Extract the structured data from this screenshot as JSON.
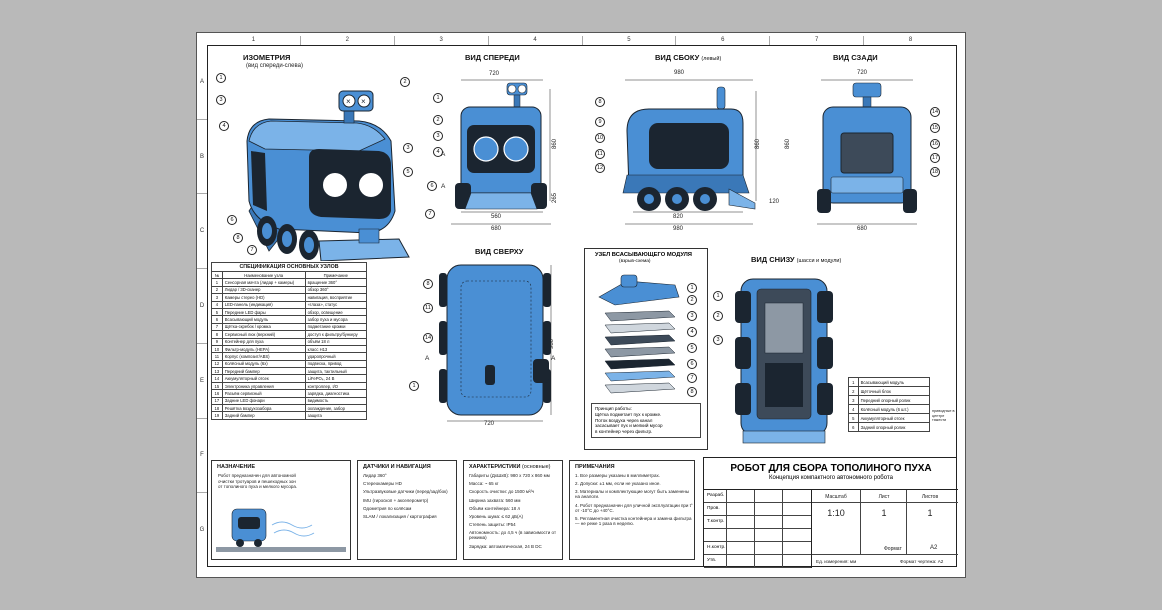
{
  "columns": [
    "1",
    "2",
    "3",
    "4",
    "5",
    "6",
    "7",
    "8"
  ],
  "rows": [
    "A",
    "B",
    "C",
    "D",
    "E",
    "F",
    "G"
  ],
  "views": {
    "iso": {
      "title": "ИЗОМЕТРИЯ",
      "subtitle": "(вид спереди-слева)"
    },
    "front": {
      "title": "ВИД СПЕРЕДИ",
      "dims": {
        "width_top": "720",
        "height": "860",
        "ground": "265",
        "inner": "560",
        "outer": "680"
      }
    },
    "side": {
      "title": "ВИД СБОКУ",
      "subtitle": "(левый)",
      "dims": {
        "length": "980",
        "height": "860",
        "wheelbase": "820",
        "full": "980",
        "clearance": "120"
      }
    },
    "rear": {
      "title": "ВИД СЗАДИ",
      "dims": {
        "width_top": "720",
        "height": "860",
        "width_bottom": "680"
      }
    },
    "top": {
      "title": "ВИД СВЕРХУ",
      "dims": {
        "length": "980",
        "width": "720"
      }
    },
    "nozzle": {
      "title": "УЗЕЛ ВСАСЫВАЮЩЕГО МОДУЛЯ",
      "subtitle": "(взрыв-схема)",
      "principle_title": "Принцип работы:",
      "principle": [
        "Щётка подметает пух к кромке.",
        "Поток воздуха через канал",
        "засасывает пух и мелкий мусор",
        "в контейнер через фильтр."
      ]
    },
    "bottom": {
      "title": "ВИД СНИЗУ",
      "subtitle": "(шасси и модули)",
      "legend": [
        {
          "n": "1",
          "label": "Всасывающий модуль"
        },
        {
          "n": "2",
          "label": "Щёточный блок"
        },
        {
          "n": "3",
          "label": "Передний опорный ролик"
        },
        {
          "n": "4",
          "label": "Колёсный модуль (6 шт.)"
        },
        {
          "n": "5",
          "label": "Аккумуляторный отсек"
        },
        {
          "n": "6",
          "label": "Задний опорный ролик"
        }
      ],
      "note": "приводные в центре тяжести"
    }
  },
  "section_marks": [
    "А",
    "А",
    "А",
    "А"
  ],
  "spec_table": {
    "title": "СПЕЦИФИКАЦИЯ ОСНОВНЫХ УЗЛОВ",
    "headers": [
      "№",
      "Наименование узла",
      "Примечание"
    ],
    "rows": [
      [
        "1",
        "Сенсорная мачта (лидар + камеры)",
        "вращение 360°"
      ],
      [
        "2",
        "Лидар / 3D-сканер",
        "обзор 360°"
      ],
      [
        "3",
        "Камеры стерео (HD)",
        "навигация, восприятие"
      ],
      [
        "4",
        "LED-панель (индикация)",
        "«глаза», статус"
      ],
      [
        "5",
        "Передние LED фары",
        "обзор, освещение"
      ],
      [
        "6",
        "Всасывающий модуль",
        "забор пуха и мусора"
      ],
      [
        "7",
        "Щётка-скребок / кромка",
        "подметание кромки"
      ],
      [
        "8",
        "Сервисный люк (верхний)",
        "доступ к фильтру/бункеру"
      ],
      [
        "9",
        "Контейнер для пуха",
        "объём 18 л"
      ],
      [
        "10",
        "Фильтр-модуль (HEPA)",
        "класс H13"
      ],
      [
        "11",
        "Корпус (композит/ABS)",
        "ударопрочный"
      ],
      [
        "12",
        "Колёсный модуль (6х)",
        "подвеска, привод"
      ],
      [
        "13",
        "Передний бампер",
        "защита, тактильный"
      ],
      [
        "14",
        "Аккумуляторный отсек",
        "LiFePO₄, 24 В"
      ],
      [
        "15",
        "Электроника управления",
        "контроллер, I/O"
      ],
      [
        "16",
        "Разъём сервисный",
        "зарядка, диагностика"
      ],
      [
        "17",
        "Задние LED фонари",
        "видимость"
      ],
      [
        "18",
        "Решётка воздухозабора",
        "охлаждение, забор"
      ],
      [
        "19",
        "Задний бампер",
        "защита"
      ]
    ]
  },
  "purpose": {
    "title": "НАЗНАЧЕНИЕ",
    "text": [
      "Робот предназначен для автономной",
      "очистки тротуаров и пешеходных зон",
      "от тополиного пуха и мелкого мусора."
    ]
  },
  "sensors": {
    "title": "ДАТЧИКИ И НАВИГАЦИЯ",
    "items": [
      "Лидар 360°",
      "Стереокамеры HD",
      "Ультразвуковые датчики (перед/зад/бок)",
      "IMU (гироскоп + акселерометр)",
      "Одометрия по колёсам",
      "SLAM / локализация / картография"
    ]
  },
  "specs": {
    "title": "ХАРАКТЕРИСТИКИ",
    "subtitle": "(основные)",
    "items": [
      "Габариты (ДхШхВ): 980 x 720 x 860 мм",
      "Масса: ~ 65 кг",
      "Скорость очистки: до 1500 м²/ч",
      "Ширина захвата: 560 мм",
      "Объём контейнера: 18 л",
      "Уровень шума: ≤ 62 дБ(А)",
      "Степень защиты: IP54",
      "Автономность: до 4,5 ч (в зависимости от режима)",
      "Зарядка: автоматическая, 24 В DC"
    ]
  },
  "notes": {
    "title": "ПРИМЕЧАНИЯ",
    "items": [
      "1. Все размеры указаны в миллиметрах.",
      "2. Допуски: ±1 мм, если не указано иное.",
      "3. Материалы и комплектующие могут быть заменены на аналоги.",
      "4. Робот предназначен для уличной эксплуатации при t° от -10°С до +40°С.",
      "5. Регламентная очистка контейнера и замена фильтра — не реже 1 раза в неделю."
    ]
  },
  "title_block": {
    "title": "РОБОТ ДЛЯ СБОРА ТОПОЛИНОГО ПУХА",
    "subtitle": "Концепция компактного автономного робота",
    "roles": [
      "Разраб.",
      "Пров.",
      "Т.контр.",
      "",
      "Н.контр.",
      "Утв."
    ],
    "scale_label": "Масштаб",
    "scale": "1:10",
    "sheet_label": "Лист",
    "sheet": "1",
    "sheets_label": "Листов",
    "sheets": "1",
    "format_label": "Формат",
    "format": "A2",
    "units": "Ед. измерения: мм",
    "format_full": "Формат чертежа: A2"
  },
  "colors": {
    "body": "#4a8fd4",
    "body_light": "#7bb3e8",
    "dark": "#1b2530",
    "line": "#222222"
  }
}
